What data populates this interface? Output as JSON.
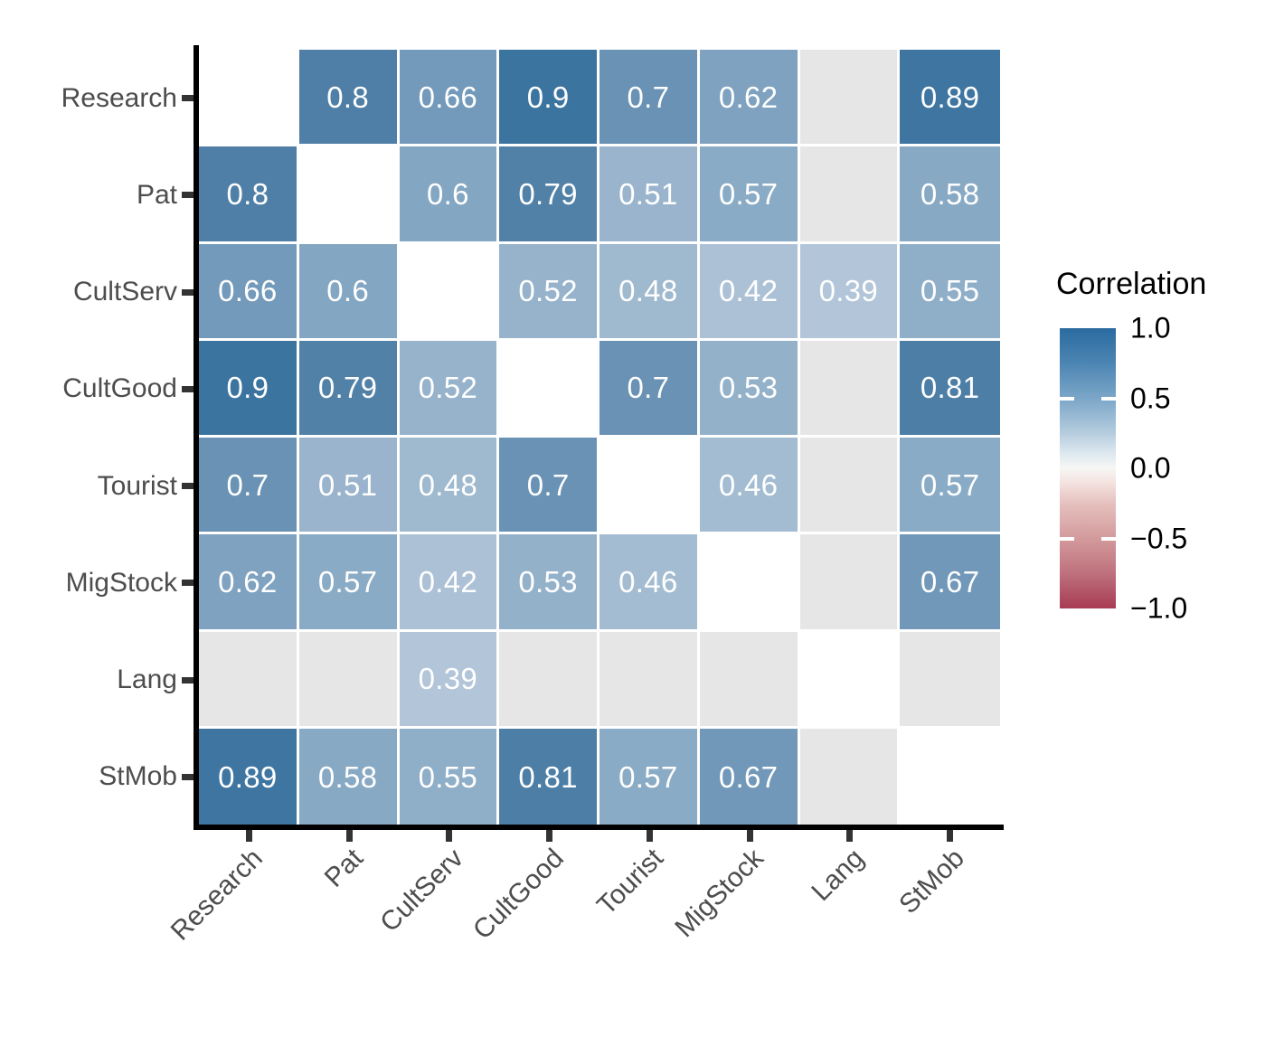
{
  "chart_data": {
    "type": "heatmap",
    "title": "",
    "xlabel": "",
    "ylabel": "",
    "legend_title": "Correlation",
    "legend_position": "right",
    "colorscale": {
      "name": "RdBu",
      "min": -1.0,
      "max": 1.0,
      "ticks": [
        "1.0",
        "0.5",
        "0.0",
        "-0.5",
        "-1.0"
      ],
      "tick_values": [
        1.0,
        0.5,
        0.0,
        -0.5,
        -1.0
      ],
      "high_color": "#2b6ba0",
      "mid_color": "#f7f7f5",
      "low_color": "#a83b53",
      "na_color": "#e6e6e6"
    },
    "x_categories": [
      "Research",
      "Pat",
      "CultServ",
      "CultGood",
      "Tourist",
      "MigStock",
      "Lang",
      "StMob"
    ],
    "y_categories": [
      "Research",
      "Pat",
      "CultServ",
      "CultGood",
      "Tourist",
      "MigStock",
      "Lang",
      "StMob"
    ],
    "matrix": [
      [
        null,
        0.8,
        0.66,
        0.9,
        0.7,
        0.62,
        "NA",
        0.89
      ],
      [
        0.8,
        null,
        0.6,
        0.79,
        0.51,
        0.57,
        "NA",
        0.58
      ],
      [
        0.66,
        0.6,
        null,
        0.52,
        0.48,
        0.42,
        0.39,
        0.55
      ],
      [
        0.9,
        0.79,
        0.52,
        null,
        0.7,
        0.53,
        "NA",
        0.81
      ],
      [
        0.7,
        0.51,
        0.48,
        0.7,
        null,
        0.46,
        "NA",
        0.57
      ],
      [
        0.62,
        0.57,
        0.42,
        0.53,
        0.46,
        null,
        "NA",
        0.67
      ],
      [
        "NA",
        "NA",
        0.39,
        "NA",
        "NA",
        "NA",
        null,
        "NA"
      ],
      [
        0.89,
        0.58,
        0.55,
        0.81,
        0.57,
        0.67,
        "NA",
        null
      ]
    ],
    "cells": [
      {
        "row": 0,
        "col": 0,
        "label": "",
        "value": null,
        "state": "blank"
      },
      {
        "row": 0,
        "col": 1,
        "label": "0.8",
        "value": 0.8,
        "state": "value"
      },
      {
        "row": 0,
        "col": 2,
        "label": "0.66",
        "value": 0.66,
        "state": "value"
      },
      {
        "row": 0,
        "col": 3,
        "label": "0.9",
        "value": 0.9,
        "state": "value"
      },
      {
        "row": 0,
        "col": 4,
        "label": "0.7",
        "value": 0.7,
        "state": "value"
      },
      {
        "row": 0,
        "col": 5,
        "label": "0.62",
        "value": 0.62,
        "state": "value"
      },
      {
        "row": 0,
        "col": 6,
        "label": "",
        "value": null,
        "state": "na"
      },
      {
        "row": 0,
        "col": 7,
        "label": "0.89",
        "value": 0.89,
        "state": "value"
      },
      {
        "row": 1,
        "col": 0,
        "label": "0.8",
        "value": 0.8,
        "state": "value"
      },
      {
        "row": 1,
        "col": 1,
        "label": "",
        "value": null,
        "state": "blank"
      },
      {
        "row": 1,
        "col": 2,
        "label": "0.6",
        "value": 0.6,
        "state": "value"
      },
      {
        "row": 1,
        "col": 3,
        "label": "0.79",
        "value": 0.79,
        "state": "value"
      },
      {
        "row": 1,
        "col": 4,
        "label": "0.51",
        "value": 0.51,
        "state": "value"
      },
      {
        "row": 1,
        "col": 5,
        "label": "0.57",
        "value": 0.57,
        "state": "value"
      },
      {
        "row": 1,
        "col": 6,
        "label": "",
        "value": null,
        "state": "na"
      },
      {
        "row": 1,
        "col": 7,
        "label": "0.58",
        "value": 0.58,
        "state": "value"
      },
      {
        "row": 2,
        "col": 0,
        "label": "0.66",
        "value": 0.66,
        "state": "value"
      },
      {
        "row": 2,
        "col": 1,
        "label": "0.6",
        "value": 0.6,
        "state": "value"
      },
      {
        "row": 2,
        "col": 2,
        "label": "",
        "value": null,
        "state": "blank"
      },
      {
        "row": 2,
        "col": 3,
        "label": "0.52",
        "value": 0.52,
        "state": "value"
      },
      {
        "row": 2,
        "col": 4,
        "label": "0.48",
        "value": 0.48,
        "state": "value"
      },
      {
        "row": 2,
        "col": 5,
        "label": "0.42",
        "value": 0.42,
        "state": "value"
      },
      {
        "row": 2,
        "col": 6,
        "label": "0.39",
        "value": 0.39,
        "state": "value"
      },
      {
        "row": 2,
        "col": 7,
        "label": "0.55",
        "value": 0.55,
        "state": "value"
      },
      {
        "row": 3,
        "col": 0,
        "label": "0.9",
        "value": 0.9,
        "state": "value"
      },
      {
        "row": 3,
        "col": 1,
        "label": "0.79",
        "value": 0.79,
        "state": "value"
      },
      {
        "row": 3,
        "col": 2,
        "label": "0.52",
        "value": 0.52,
        "state": "value"
      },
      {
        "row": 3,
        "col": 3,
        "label": "",
        "value": null,
        "state": "blank"
      },
      {
        "row": 3,
        "col": 4,
        "label": "0.7",
        "value": 0.7,
        "state": "value"
      },
      {
        "row": 3,
        "col": 5,
        "label": "0.53",
        "value": 0.53,
        "state": "value"
      },
      {
        "row": 3,
        "col": 6,
        "label": "",
        "value": null,
        "state": "na"
      },
      {
        "row": 3,
        "col": 7,
        "label": "0.81",
        "value": 0.81,
        "state": "value"
      },
      {
        "row": 4,
        "col": 0,
        "label": "0.7",
        "value": 0.7,
        "state": "value"
      },
      {
        "row": 4,
        "col": 1,
        "label": "0.51",
        "value": 0.51,
        "state": "value"
      },
      {
        "row": 4,
        "col": 2,
        "label": "0.48",
        "value": 0.48,
        "state": "value"
      },
      {
        "row": 4,
        "col": 3,
        "label": "0.7",
        "value": 0.7,
        "state": "value"
      },
      {
        "row": 4,
        "col": 4,
        "label": "",
        "value": null,
        "state": "blank"
      },
      {
        "row": 4,
        "col": 5,
        "label": "0.46",
        "value": 0.46,
        "state": "value"
      },
      {
        "row": 4,
        "col": 6,
        "label": "",
        "value": null,
        "state": "na"
      },
      {
        "row": 4,
        "col": 7,
        "label": "0.57",
        "value": 0.57,
        "state": "value"
      },
      {
        "row": 5,
        "col": 0,
        "label": "0.62",
        "value": 0.62,
        "state": "value"
      },
      {
        "row": 5,
        "col": 1,
        "label": "0.57",
        "value": 0.57,
        "state": "value"
      },
      {
        "row": 5,
        "col": 2,
        "label": "0.42",
        "value": 0.42,
        "state": "value"
      },
      {
        "row": 5,
        "col": 3,
        "label": "0.53",
        "value": 0.53,
        "state": "value"
      },
      {
        "row": 5,
        "col": 4,
        "label": "0.46",
        "value": 0.46,
        "state": "value"
      },
      {
        "row": 5,
        "col": 5,
        "label": "",
        "value": null,
        "state": "blank"
      },
      {
        "row": 5,
        "col": 6,
        "label": "",
        "value": null,
        "state": "na"
      },
      {
        "row": 5,
        "col": 7,
        "label": "0.67",
        "value": 0.67,
        "state": "value"
      },
      {
        "row": 6,
        "col": 0,
        "label": "",
        "value": null,
        "state": "na"
      },
      {
        "row": 6,
        "col": 1,
        "label": "",
        "value": null,
        "state": "na"
      },
      {
        "row": 6,
        "col": 2,
        "label": "0.39",
        "value": 0.39,
        "state": "value"
      },
      {
        "row": 6,
        "col": 3,
        "label": "",
        "value": null,
        "state": "na"
      },
      {
        "row": 6,
        "col": 4,
        "label": "",
        "value": null,
        "state": "na"
      },
      {
        "row": 6,
        "col": 5,
        "label": "",
        "value": null,
        "state": "na"
      },
      {
        "row": 6,
        "col": 6,
        "label": "",
        "value": null,
        "state": "blank"
      },
      {
        "row": 6,
        "col": 7,
        "label": "",
        "value": null,
        "state": "na"
      },
      {
        "row": 7,
        "col": 0,
        "label": "0.89",
        "value": 0.89,
        "state": "value"
      },
      {
        "row": 7,
        "col": 1,
        "label": "0.58",
        "value": 0.58,
        "state": "value"
      },
      {
        "row": 7,
        "col": 2,
        "label": "0.55",
        "value": 0.55,
        "state": "value"
      },
      {
        "row": 7,
        "col": 3,
        "label": "0.81",
        "value": 0.81,
        "state": "value"
      },
      {
        "row": 7,
        "col": 4,
        "label": "0.57",
        "value": 0.57,
        "state": "value"
      },
      {
        "row": 7,
        "col": 5,
        "label": "0.67",
        "value": 0.67,
        "state": "value"
      },
      {
        "row": 7,
        "col": 6,
        "label": "",
        "value": null,
        "state": "na"
      },
      {
        "row": 7,
        "col": 7,
        "label": "",
        "value": null,
        "state": "blank"
      }
    ]
  },
  "legend": {
    "title": "Correlation",
    "ticks": [
      {
        "label": "1.0",
        "value": 1.0
      },
      {
        "label": "0.5",
        "value": 0.5
      },
      {
        "label": "0.0",
        "value": 0.0
      },
      {
        "label": "−0.5",
        "value": -0.5
      },
      {
        "label": "−1.0",
        "value": -1.0
      }
    ]
  },
  "axes": {
    "y_labels": [
      "Research",
      "Pat",
      "CultServ",
      "CultGood",
      "Tourist",
      "MigStock",
      "Lang",
      "StMob"
    ],
    "x_labels": [
      "Research",
      "Pat",
      "CultServ",
      "CultGood",
      "Tourist",
      "MigStock",
      "Lang",
      "StMob"
    ]
  }
}
